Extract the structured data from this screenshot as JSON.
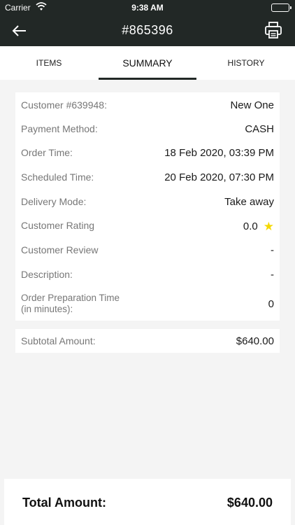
{
  "status_bar": {
    "carrier": "Carrier",
    "time": "9:38 AM",
    "icons": [
      "wifi-icon",
      "battery-icon"
    ]
  },
  "nav": {
    "title": "#865396",
    "back_icon": "back-arrow-icon",
    "print_icon": "printer-icon"
  },
  "tabs": [
    {
      "label": "ITEMS",
      "active": false
    },
    {
      "label": "SUMMARY",
      "active": true
    },
    {
      "label": "HISTORY",
      "active": false
    }
  ],
  "details": [
    {
      "label": "Customer #639948:",
      "value": "New One"
    },
    {
      "label": "Payment Method:",
      "value": "CASH"
    },
    {
      "label": "Order Time:",
      "value": "18 Feb 2020, 03:39 PM"
    },
    {
      "label": "Scheduled Time:",
      "value": "20 Feb 2020, 07:30 PM"
    },
    {
      "label": "Delivery Mode:",
      "value": "Take away"
    },
    {
      "label": "Customer Rating",
      "value": "0.0",
      "icon": "star-icon"
    },
    {
      "label": "Customer Review",
      "value": "-"
    },
    {
      "label": "Description:",
      "value": "-"
    },
    {
      "label_line1": "Order Preparation Time",
      "label_line2": "(in minutes):",
      "value": "0"
    }
  ],
  "subtotal": {
    "label": "Subtotal Amount:",
    "value": "$640.00"
  },
  "total": {
    "label": "Total Amount:",
    "value": "$640.00"
  },
  "colors": {
    "header_bg": "#222826",
    "page_bg": "#f4f4f4",
    "star": "#f5d800",
    "label": "#777777"
  }
}
